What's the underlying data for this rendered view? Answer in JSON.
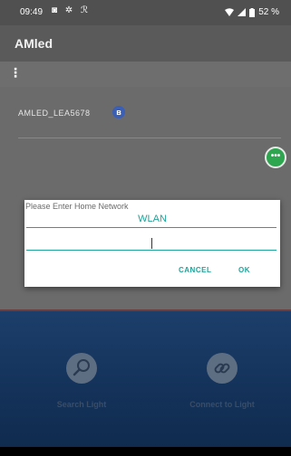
{
  "status_bar": {
    "time": "09:49",
    "battery": "52 %"
  },
  "app": {
    "title": "AMled",
    "menu_glyph": "⋮"
  },
  "device_list": {
    "items": [
      {
        "name": "AMLED_LEA5678",
        "icon": "bluetooth-icon",
        "badge": "ʙ"
      }
    ]
  },
  "fab": {
    "glyph": "•••",
    "icon": "more-icon"
  },
  "dialog": {
    "title": "Please Enter Home Network",
    "ssid": "WLAN",
    "password_value": "",
    "cancel_label": "CANCEL",
    "ok_label": "OK",
    "accent": "#1fa39a"
  },
  "actions": {
    "search": {
      "label": "Search Light",
      "icon": "search-icon"
    },
    "connect": {
      "label": "Connect to Light",
      "icon": "link-icon"
    }
  },
  "colors": {
    "fab": "#2ea64f",
    "bluetooth_badge": "#3b5fb5",
    "panel_top": "#1c3f6b"
  }
}
